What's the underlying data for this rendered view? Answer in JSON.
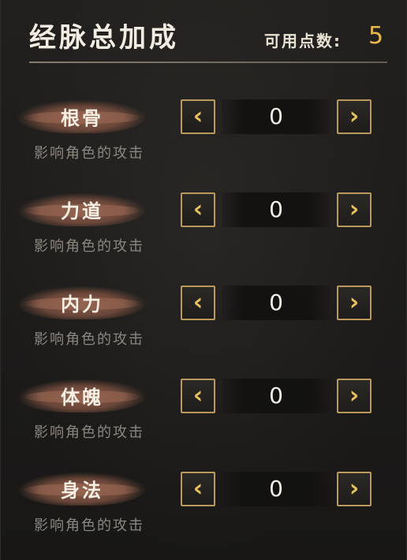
{
  "header": {
    "title": "经脉总加成",
    "points_label": "可用点数:",
    "points_value": "5"
  },
  "stats": [
    {
      "name": "根骨",
      "value": "0",
      "desc": "影响角色的攻击"
    },
    {
      "name": "力道",
      "value": "0",
      "desc": "影响角色的攻击"
    },
    {
      "name": "内力",
      "value": "0",
      "desc": "影响角色的攻击"
    },
    {
      "name": "体魄",
      "value": "0",
      "desc": "影响角色的攻击"
    },
    {
      "name": "身法",
      "value": "0",
      "desc": "影响角色的攻击"
    }
  ],
  "icons": {
    "decrease": "chevron-left-icon",
    "increase": "chevron-right-icon"
  },
  "arrows": {
    "left": "‹",
    "right": "›"
  },
  "colors": {
    "accent_gold": "#e7b84a",
    "button_border": "#b99a5c",
    "label_brush": "#8c5c4a",
    "description_gray": "#8c8680"
  }
}
